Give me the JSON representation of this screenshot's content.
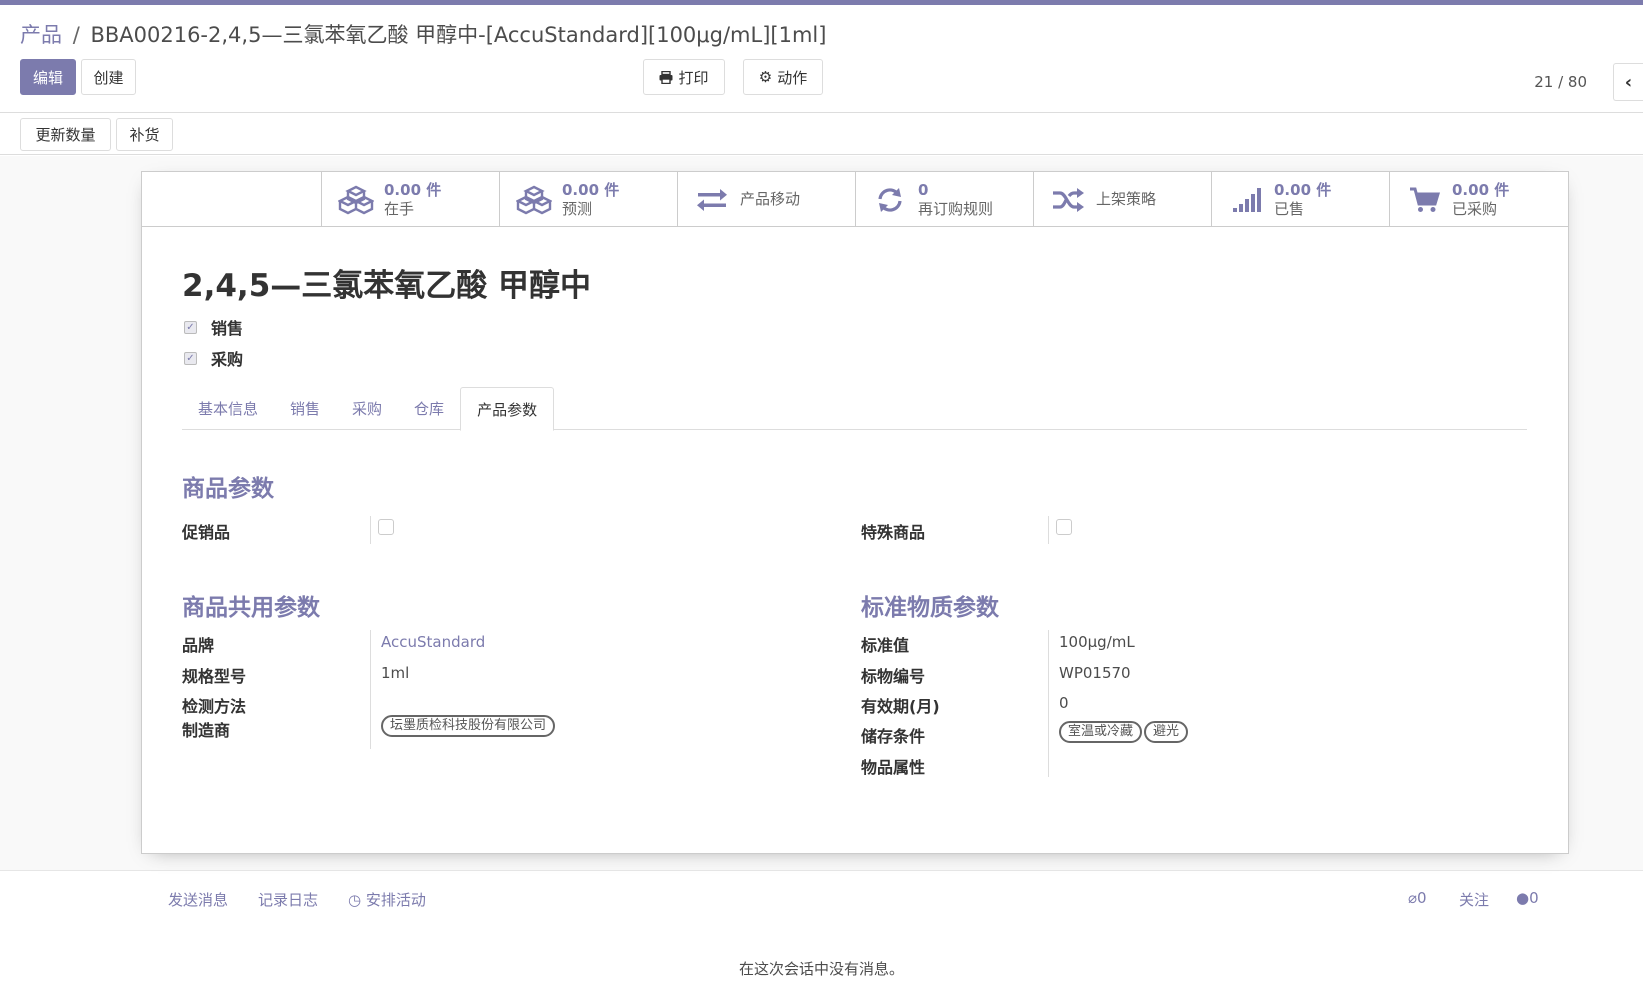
{
  "breadcrumb": {
    "parent": "产品",
    "separator": "/",
    "current": "BBA00216-2,4,5—三氯苯氧乙酸 甲醇中-[AccuStandard][100μg/mL][1ml]"
  },
  "toolbar": {
    "edit_label": "编辑",
    "create_label": "创建",
    "print_label": "打印",
    "action_label": "动作"
  },
  "pager": {
    "value": "21 / 80"
  },
  "statusbar": {
    "update_qty_label": "更新数量",
    "replenish_label": "补货"
  },
  "stat_buttons": {
    "on_hand": {
      "value": "0.00 件",
      "label": "在手",
      "icon": "cubes-icon"
    },
    "forecast": {
      "value": "0.00 件",
      "label": "预测",
      "icon": "cubes-icon"
    },
    "moves": {
      "label": "产品移动",
      "icon": "exchange-icon"
    },
    "reorder": {
      "value": "0",
      "label": "再订购规则",
      "icon": "refresh-icon"
    },
    "putaway": {
      "label": "上架策略",
      "icon": "random-icon"
    },
    "sold": {
      "value": "0.00 件",
      "label": "已售",
      "icon": "signal-icon"
    },
    "purchased": {
      "value": "0.00 件",
      "label": "已采购",
      "icon": "cart-icon"
    }
  },
  "product": {
    "name": "2,4,5—三氯苯氧乙酸 甲醇中",
    "sale_ok_label": "销售",
    "purchase_ok_label": "采购",
    "sale_ok": true,
    "purchase_ok": true
  },
  "tabs": [
    "基本信息",
    "销售",
    "采购",
    "仓库",
    "产品参数"
  ],
  "active_tab": "产品参数",
  "params": {
    "section_goods": "商品参数",
    "promo_label": "促销品",
    "special_label": "特殊商品",
    "promo_checked": false,
    "special_checked": false,
    "section_common": "商品共用参数",
    "section_standard": "标准物质参数",
    "brand_label": "品牌",
    "brand_value": "AccuStandard",
    "spec_label": "规格型号",
    "spec_value": "1ml",
    "method_label": "检测方法",
    "method_value": "",
    "maker_label": "制造商",
    "maker_tag": "坛墨质检科技股份有限公司",
    "std_value_label": "标准值",
    "std_value": "100μg/mL",
    "std_code_label": "标物编号",
    "std_code": "WP01570",
    "validity_label": "有效期(月)",
    "validity_value": "0",
    "storage_label": "储存条件",
    "storage_tags": [
      "室温或冷藏",
      "避光"
    ],
    "attr_label": "物品属性"
  },
  "chatter": {
    "send_message": "发送消息",
    "log_note": "记录日志",
    "schedule_activity": "安排活动",
    "attachments_count": "0",
    "follow_label": "关注",
    "followers_count": "0",
    "empty_message": "在这次会话中没有消息。"
  },
  "colors": {
    "accent": "#7c7bad",
    "text": "#4c4c4c"
  }
}
